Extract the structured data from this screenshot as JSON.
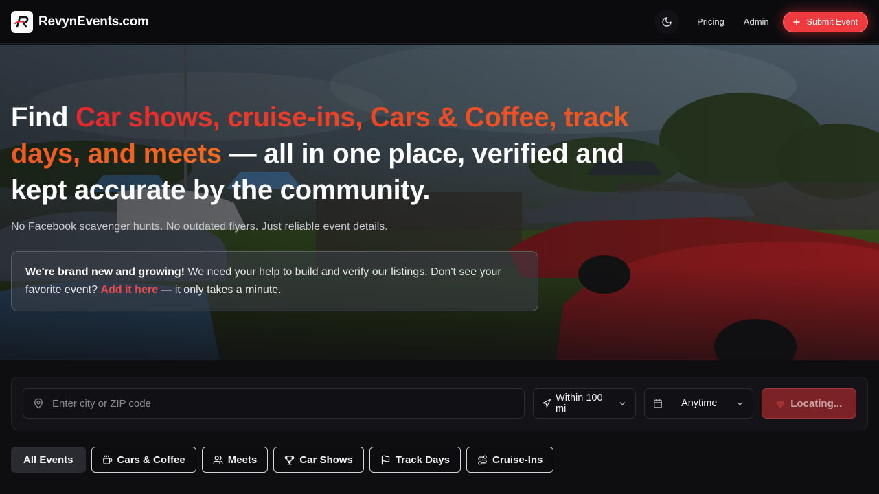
{
  "header": {
    "brand": "RevynEvents.com",
    "nav": {
      "pricing": "Pricing",
      "admin": "Admin",
      "submit": "Submit Event"
    },
    "icons": {
      "theme": "moon-icon",
      "submit": "plus-icon"
    }
  },
  "hero": {
    "headline_prefix": "Find ",
    "headline_accent": "Car shows, cruise-ins, Cars & Coffee, track days, and meets",
    "headline_suffix": " — all in one place, verified and kept accurate by the community.",
    "subline": "No Facebook scavenger hunts. No outdated flyers. Just reliable event details.",
    "notice": {
      "bold": "We're brand new and growing!",
      "text": " We need your help to build and verify our listings. Don't see your favorite event? ",
      "link": "Add it here",
      "tail": " — it only takes a minute."
    }
  },
  "search": {
    "placeholder": "Enter city or ZIP code",
    "radius": "Within 100 mi",
    "date": "Anytime",
    "locate": "Locating..."
  },
  "filters": [
    {
      "label": "All Events",
      "icon": ""
    },
    {
      "label": "Cars & Coffee",
      "icon": "coffee-icon"
    },
    {
      "label": "Meets",
      "icon": "users-icon"
    },
    {
      "label": "Car Shows",
      "icon": "trophy-icon"
    },
    {
      "label": "Track Days",
      "icon": "flag-icon"
    },
    {
      "label": "Cruise-Ins",
      "icon": "route-icon"
    }
  ],
  "colors": {
    "accent": "#ef3b40",
    "accent_orange": "#f06a21",
    "background": "#0e0e11"
  }
}
